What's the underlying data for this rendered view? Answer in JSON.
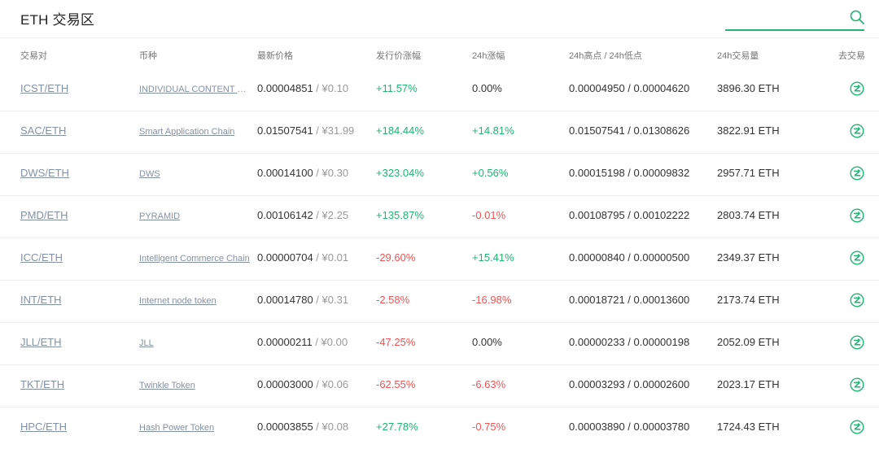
{
  "header": {
    "title": "ETH 交易区",
    "search_value": "",
    "search_icon": "search-icon"
  },
  "colors": {
    "accent": "#1fb573",
    "up": "#1fb573",
    "down": "#f05454",
    "link": "#8491a5"
  },
  "columns": {
    "pair": "交易对",
    "coin": "币种",
    "price": "最新价格",
    "issue_change": "发行价涨幅",
    "change_24h": "24h涨幅",
    "high_low": "24h高点 / 24h低点",
    "volume": "24h交易量",
    "trade": "去交易"
  },
  "rows": [
    {
      "pair": "ICST/ETH",
      "coin": "INDIVIDUAL CONTENT & SOCIAL TOKEN",
      "price": "0.00004851",
      "cny": " / ¥0.10",
      "issue_change": "+11.57%",
      "issue_dir": "up",
      "change": "0.00%",
      "change_dir": "flat",
      "high_low": "0.00004950 / 0.00004620",
      "volume": "3896.30 ETH"
    },
    {
      "pair": "SAC/ETH",
      "coin": "Smart Application Chain",
      "price": "0.01507541",
      "cny": " / ¥31.99",
      "issue_change": "+184.44%",
      "issue_dir": "up",
      "change": "+14.81%",
      "change_dir": "up",
      "high_low": "0.01507541 / 0.01308626",
      "volume": "3822.91 ETH"
    },
    {
      "pair": "DWS/ETH",
      "coin": "DWS",
      "price": "0.00014100",
      "cny": " / ¥0.30",
      "issue_change": "+323.04%",
      "issue_dir": "up",
      "change": "+0.56%",
      "change_dir": "up",
      "high_low": "0.00015198 / 0.00009832",
      "volume": "2957.71 ETH"
    },
    {
      "pair": "PMD/ETH",
      "coin": "PYRAMID",
      "price": "0.00106142",
      "cny": " / ¥2.25",
      "issue_change": "+135.87%",
      "issue_dir": "up",
      "change": "-0.01%",
      "change_dir": "down",
      "high_low": "0.00108795 / 0.00102222",
      "volume": "2803.74 ETH"
    },
    {
      "pair": "ICC/ETH",
      "coin": "Intelligent Commerce Chain",
      "price": "0.00000704",
      "cny": " / ¥0.01",
      "issue_change": "-29.60%",
      "issue_dir": "down",
      "change": "+15.41%",
      "change_dir": "up",
      "high_low": "0.00000840 / 0.00000500",
      "volume": "2349.37 ETH"
    },
    {
      "pair": "INT/ETH",
      "coin": "Internet node token",
      "price": "0.00014780",
      "cny": " / ¥0.31",
      "issue_change": "-2.58%",
      "issue_dir": "down",
      "change": "-16.98%",
      "change_dir": "down",
      "high_low": "0.00018721 / 0.00013600",
      "volume": "2173.74 ETH"
    },
    {
      "pair": "JLL/ETH",
      "coin": "JLL",
      "price": "0.00000211",
      "cny": " / ¥0.00",
      "issue_change": "-47.25%",
      "issue_dir": "down",
      "change": "0.00%",
      "change_dir": "flat",
      "high_low": "0.00000233 / 0.00000198",
      "volume": "2052.09 ETH"
    },
    {
      "pair": "TKT/ETH",
      "coin": "Twinkle Token",
      "price": "0.00003000",
      "cny": " / ¥0.06",
      "issue_change": "-62.55%",
      "issue_dir": "down",
      "change": "-6.63%",
      "change_dir": "down",
      "high_low": "0.00003293 / 0.00002600",
      "volume": "2023.17 ETH"
    },
    {
      "pair": "HPC/ETH",
      "coin": "Hash Power Token",
      "price": "0.00003855",
      "cny": " / ¥0.08",
      "issue_change": "+27.78%",
      "issue_dir": "up",
      "change": "-0.75%",
      "change_dir": "down",
      "high_low": "0.00003890 / 0.00003780",
      "volume": "1724.43 ETH"
    }
  ]
}
